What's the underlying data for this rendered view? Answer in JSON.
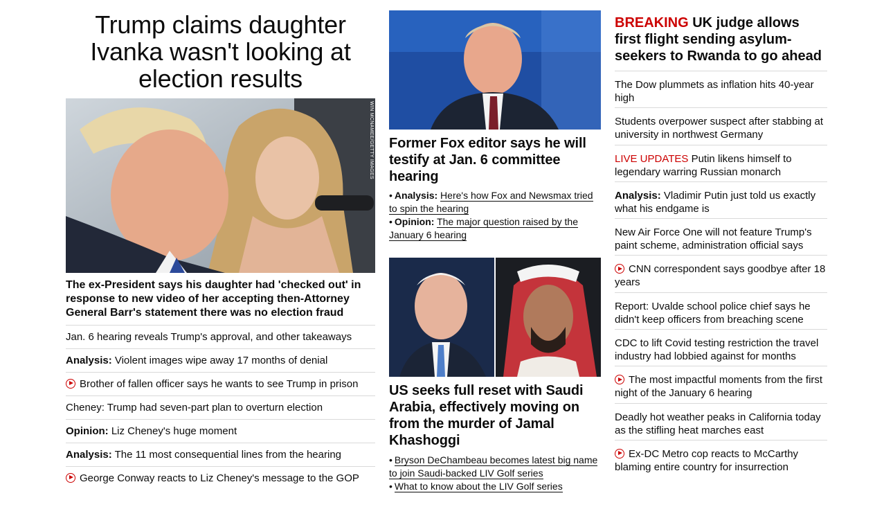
{
  "col1": {
    "headline": "Trump claims daughter Ivanka wasn't looking at election results",
    "photo_credit": "WIN MCNAMEE/GETTY IMAGES",
    "caption": "The ex-President says his daughter had 'checked out' in response to new video of her accepting then-Attorney General Barr's statement there was no election fraud",
    "items": [
      {
        "label": "",
        "text": "Jan. 6 hearing reveals Trump's approval, and other takeaways",
        "video": false
      },
      {
        "label": "Analysis:",
        "text": " Violent images wipe away 17 months of denial",
        "video": false
      },
      {
        "label": "",
        "text": "Brother of fallen officer says he wants to see Trump in prison",
        "video": true
      },
      {
        "label": "",
        "text": "Cheney: Trump had seven-part plan to overturn election",
        "video": false
      },
      {
        "label": "Opinion:",
        "text": " Liz Cheney's huge moment",
        "video": false
      },
      {
        "label": "Analysis:",
        "text": " The 11 most consequential lines from the hearing",
        "video": false
      },
      {
        "label": "",
        "text": "George Conway reacts to Liz Cheney's message to the GOP",
        "video": true
      }
    ]
  },
  "col2": {
    "story1": {
      "headline": "Former Fox editor says he will testify at Jan. 6 committee hearing",
      "sub": [
        {
          "label": "Analysis:",
          "text": "Here's how Fox and Newsmax tried to spin the hearing"
        },
        {
          "label": "Opinion:",
          "text": "The major question raised by the January 6 hearing"
        }
      ]
    },
    "story2": {
      "headline": "US seeks full reset with Saudi Arabia, effectively moving on from the murder of Jamal Khashoggi",
      "sub": [
        {
          "label": "",
          "text": "Bryson DeChambeau becomes latest big name to join Saudi-backed LIV Golf series"
        },
        {
          "label": "",
          "text": "What to know about the LIV Golf series"
        }
      ]
    }
  },
  "col3": {
    "breaking_tag": "BREAKING",
    "breaking_text": " UK judge allows first flight sending asylum-seekers to Rwanda to go ahead",
    "items": [
      {
        "label": "",
        "red": "",
        "text": "The Dow plummets as inflation hits 40-year high",
        "video": false
      },
      {
        "label": "",
        "red": "",
        "text": "Students overpower suspect after stabbing at university in northwest Germany",
        "video": false
      },
      {
        "label": "",
        "red": "LIVE UPDATES",
        "text": " Putin likens himself to legendary warring Russian monarch",
        "video": false
      },
      {
        "label": "Analysis:",
        "red": "",
        "text": " Vladimir Putin just told us exactly what his endgame is",
        "video": false
      },
      {
        "label": "",
        "red": "",
        "text": "New Air Force One will not feature Trump's paint scheme, administration official says",
        "video": false
      },
      {
        "label": "",
        "red": "",
        "text": "CNN correspondent says goodbye after 18 years",
        "video": true
      },
      {
        "label": "",
        "red": "",
        "text": "Report: Uvalde school police chief says he didn't keep officers from breaching scene",
        "video": false
      },
      {
        "label": "",
        "red": "",
        "text": "CDC to lift Covid testing restriction the travel industry had lobbied against for months",
        "video": false
      },
      {
        "label": "",
        "red": "",
        "text": "The most impactful moments from the first night of the January 6 hearing",
        "video": true
      },
      {
        "label": "",
        "red": "",
        "text": "Deadly hot weather peaks in California today as the stifling heat marches east",
        "video": false
      },
      {
        "label": "",
        "red": "",
        "text": "Ex-DC Metro cop reacts to McCarthy blaming entire country for insurrection",
        "video": true
      }
    ]
  }
}
